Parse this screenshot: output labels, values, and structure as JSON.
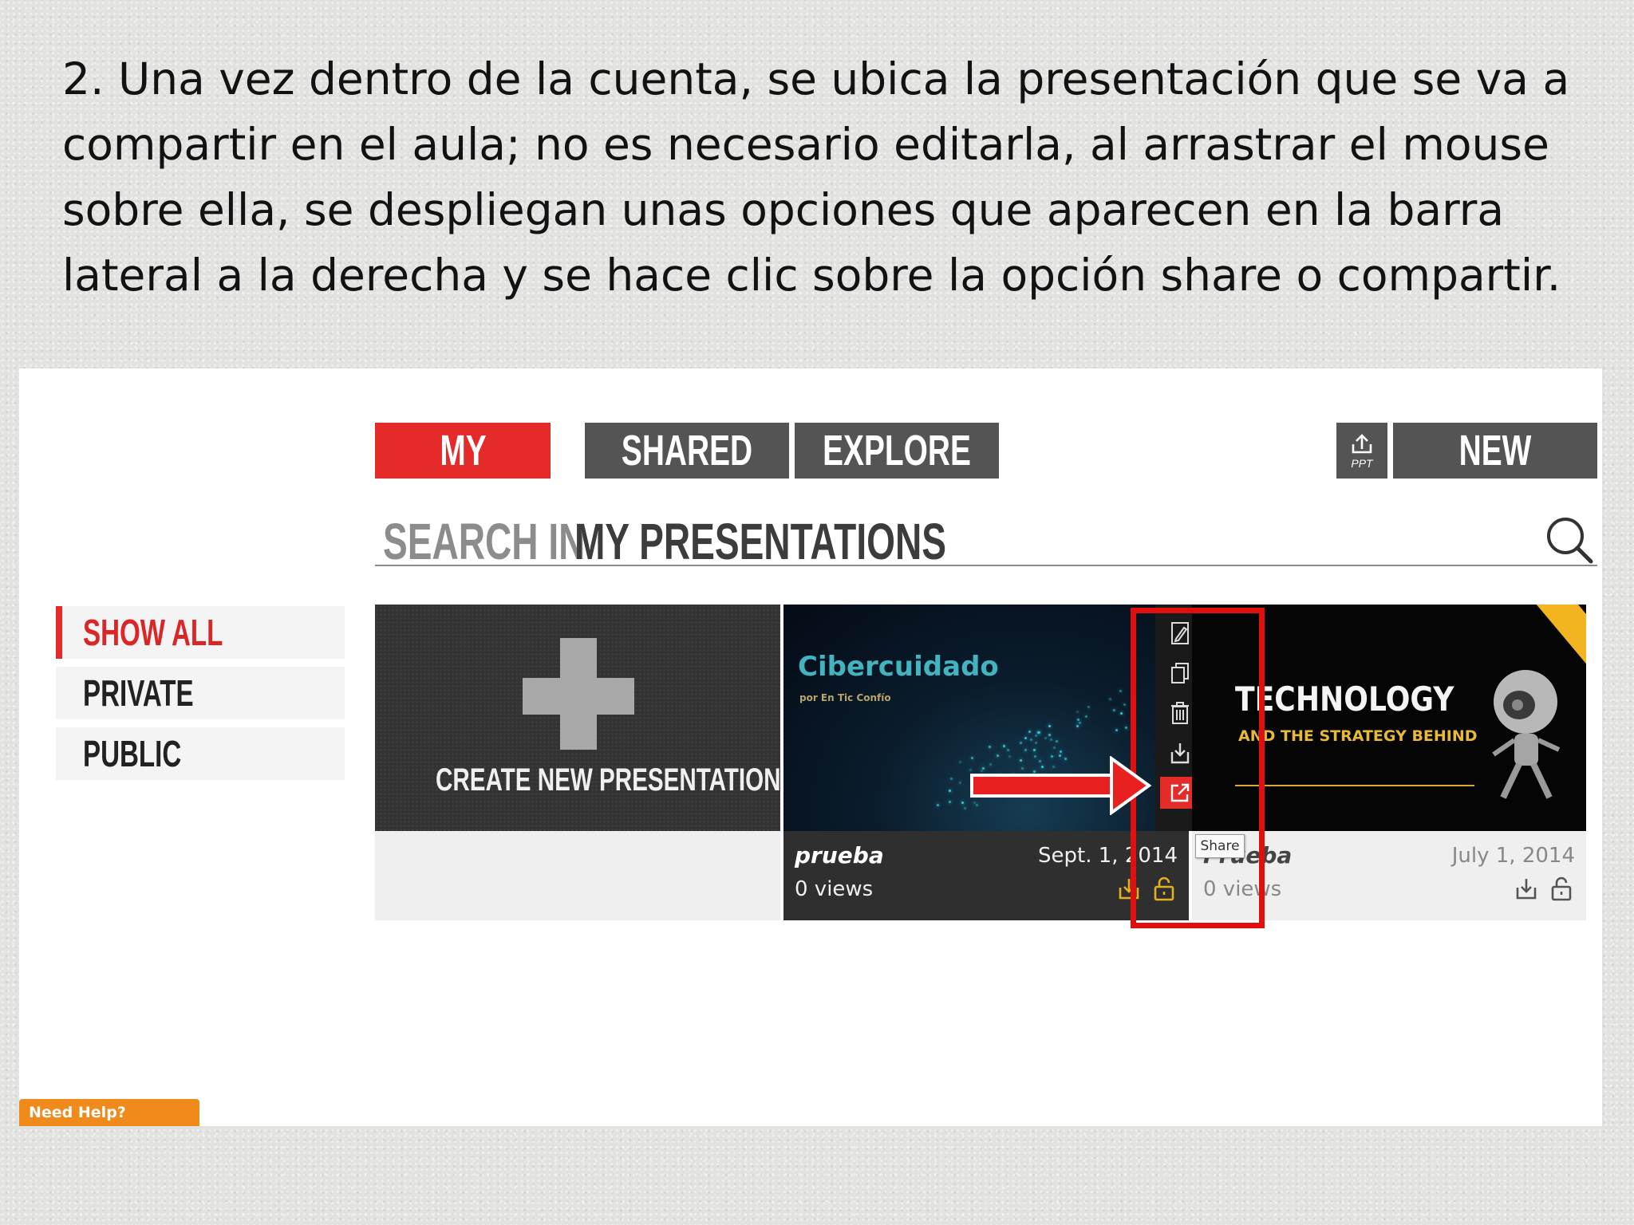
{
  "instruction": "2. Una vez dentro de la cuenta, se ubica la presentación que se va a compartir en el aula; no es necesario editarla, al arrastrar el mouse sobre ella, se despliegan unas opciones que aparecen en la barra lateral a la derecha y se hace clic sobre la opción share o compartir.",
  "tabs": {
    "my": "MY",
    "shared": "SHARED",
    "explore": "EXPLORE",
    "new": "NEW"
  },
  "upload_ppt_label": "PPT",
  "search": {
    "prefix": "SEARCH IN",
    "main": "MY PRESENTATIONS"
  },
  "filters": {
    "show_all": "SHOW ALL",
    "private": "PRIVATE",
    "public": "PUBLIC"
  },
  "create_card": {
    "label": "CREATE NEW PRESENTATION"
  },
  "presentations": [
    {
      "thumb_title": "Cibercuidado",
      "thumb_subtitle": "por En Tic Confío",
      "title": "prueba",
      "views": "0 views",
      "date": "Sept. 1, 2014"
    },
    {
      "thumb_title": "TECHNOLOGY",
      "thumb_subtitle": "AND THE STRATEGY BEHIND",
      "title": "Prueba",
      "views": "0 views",
      "date": "July 1, 2014"
    }
  ],
  "action_bar": {
    "icons": [
      "edit-icon",
      "copy-icon",
      "trash-icon",
      "download-icon",
      "share-icon"
    ]
  },
  "tooltip": "Share",
  "help": "Need Help?",
  "colors": {
    "accent": "#e52a2a",
    "tab_dark": "#545454",
    "highlight": "#e01010",
    "help_orange": "#f08a1a"
  }
}
